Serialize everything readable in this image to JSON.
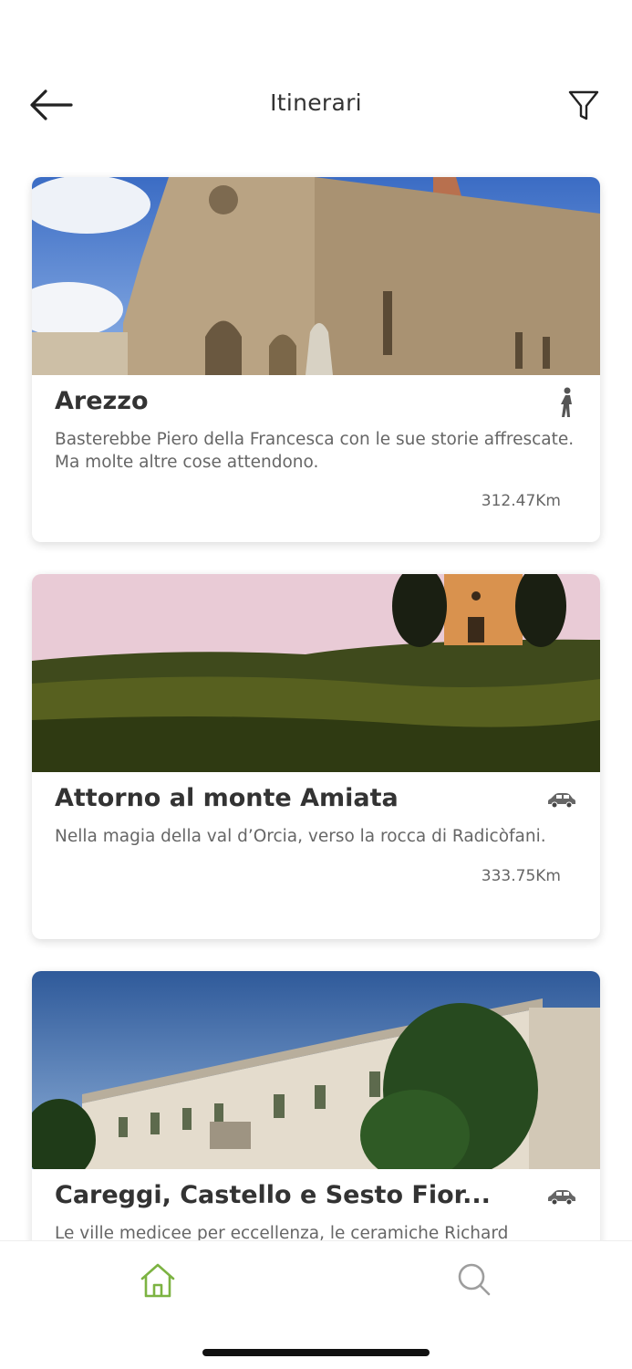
{
  "header": {
    "title": "Itinerari",
    "back_icon": "arrow-left-icon",
    "filter_icon": "filter-funnel-icon"
  },
  "itineraries": [
    {
      "title": "Arezzo",
      "description": "Basterebbe Piero della Francesca con le sue storie affrescate. Ma molte altre cose attendono.",
      "distance": "312.47Km",
      "mode": "walking-icon",
      "image": "cathedral photo"
    },
    {
      "title": "Attorno al monte Amiata",
      "description": "Nella magia della val d’Orcia, verso la rocca di Radicòfani.",
      "distance": "333.75Km",
      "mode": "car-icon",
      "image": "hill chapel photo"
    },
    {
      "title": "Careggi, Castello e Sesto Fior...",
      "description": "Le ville medicee per eccellenza, le ceramiche Richard",
      "mode": "car-icon",
      "image": "villa photo"
    }
  ],
  "tabbar": {
    "home_icon": "home-icon",
    "search_icon": "search-icon",
    "active_color": "#7cb342",
    "inactive_color": "#9e9e9e"
  }
}
